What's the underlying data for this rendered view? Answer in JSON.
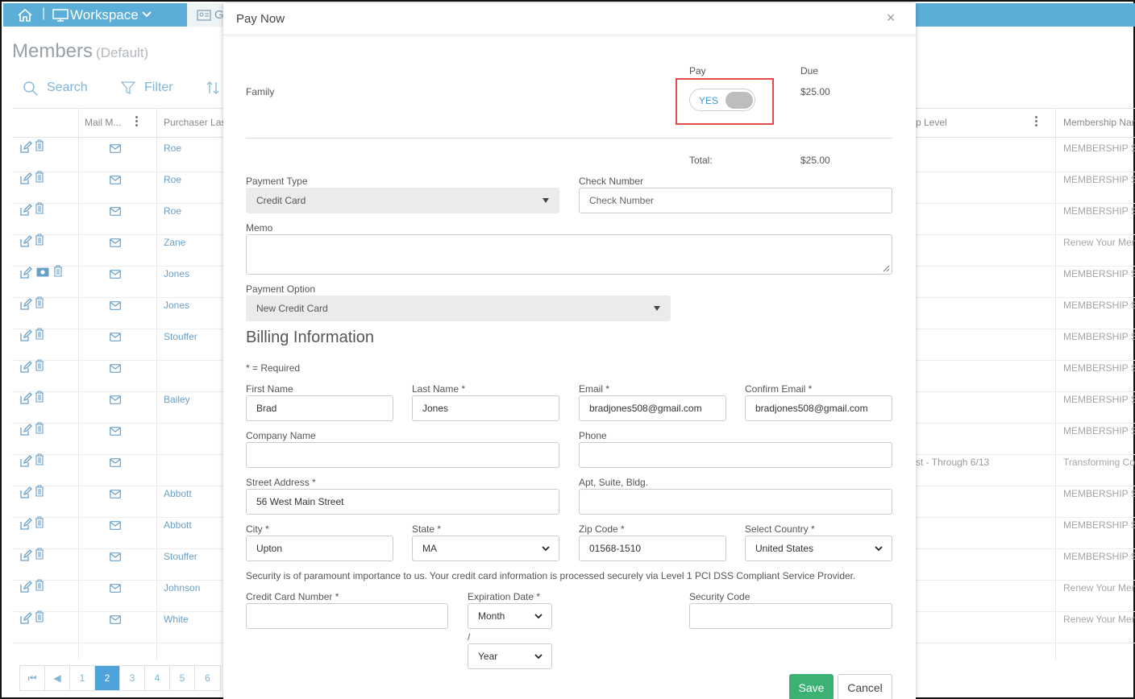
{
  "topbar": {
    "workspace_label": "Workspace",
    "tab2_label": "G"
  },
  "page": {
    "title": "Members",
    "subtitle": "(Default)"
  },
  "toolbar": {
    "search_label": "Search",
    "filter_label": "Filter"
  },
  "grid": {
    "columns": {
      "mail": "Mail M...",
      "purchaser": "Purchaser Las",
      "level": "p Level",
      "membership": "Membership Nar"
    },
    "rows": [
      {
        "last": "Roe",
        "level": "",
        "membership": "MEMBERSHIP SE",
        "money": false
      },
      {
        "last": "Roe",
        "level": "",
        "membership": "MEMBERSHIP SE",
        "money": false
      },
      {
        "last": "Roe",
        "level": "",
        "membership": "MEMBERSHIP SE",
        "money": false
      },
      {
        "last": "Zane",
        "level": "",
        "membership": "Renew Your Men",
        "money": false
      },
      {
        "last": "Jones",
        "level": "",
        "membership": "MEMBERSHIP SE",
        "money": true
      },
      {
        "last": "Jones",
        "level": "",
        "membership": "MEMBERSHIP SE",
        "money": false
      },
      {
        "last": "Stouffer",
        "level": "",
        "membership": "MEMBERSHIP SE",
        "money": false
      },
      {
        "last": "",
        "level": "",
        "membership": "MEMBERSHIP SE",
        "money": false
      },
      {
        "last": "Bailey",
        "level": "",
        "membership": "MEMBERSHIP SE",
        "money": false
      },
      {
        "last": "",
        "level": "",
        "membership": "MEMBERSHIP SE",
        "money": false
      },
      {
        "last": "",
        "level": "st - Through 6/13",
        "membership": "Transforming Co",
        "money": false
      },
      {
        "last": "Abbott",
        "level": "",
        "membership": "MEMBERSHIP SE",
        "money": false
      },
      {
        "last": "Abbott",
        "level": "",
        "membership": "MEMBERSHIP SE",
        "money": false
      },
      {
        "last": "Stouffer",
        "level": "",
        "membership": "MEMBERSHIP SE",
        "money": false
      },
      {
        "last": "Johnson",
        "level": "",
        "membership": "Renew Your Men",
        "money": false
      },
      {
        "last": "White",
        "level": "",
        "membership": "Renew Your Men",
        "money": false
      }
    ]
  },
  "pager": {
    "pages": [
      "1",
      "2",
      "3",
      "4",
      "5",
      "6"
    ],
    "current": "2"
  },
  "modal": {
    "title": "Pay Now",
    "close": "×",
    "pay_header": "Pay",
    "due_header": "Due",
    "item_label": "Family",
    "toggle_label": "YES",
    "toggle_on": true,
    "due_amount": "$25.00",
    "total_label": "Total:",
    "total_amount": "$25.00",
    "payment_type": {
      "label": "Payment Type",
      "value": "Credit Card"
    },
    "check_number": {
      "label": "Check Number",
      "placeholder": "Check Number"
    },
    "memo": {
      "label": "Memo"
    },
    "payment_option": {
      "label": "Payment Option",
      "value": "New Credit Card"
    },
    "billing": {
      "title": "Billing Information",
      "required_note": "* = Required",
      "first_name": {
        "label": "First Name",
        "value": "Brad"
      },
      "last_name": {
        "label": "Last Name *",
        "value": "Jones"
      },
      "email": {
        "label": "Email *",
        "value": "bradjones508@gmail.com"
      },
      "confirm_email": {
        "label": "Confirm Email *",
        "value": "bradjones508@gmail.com"
      },
      "company": {
        "label": "Company Name",
        "value": ""
      },
      "phone": {
        "label": "Phone",
        "value": ""
      },
      "street": {
        "label": "Street Address *",
        "value": "56 West Main Street"
      },
      "apt": {
        "label": "Apt, Suite, Bldg.",
        "value": ""
      },
      "city": {
        "label": "City *",
        "value": "Upton"
      },
      "state": {
        "label": "State *",
        "value": "MA"
      },
      "zip": {
        "label": "Zip Code *",
        "value": "01568-1510"
      },
      "country": {
        "label": "Select Country *",
        "value": "United States"
      },
      "security_note": "Security is of paramount importance to us. Your credit card information is processed securely via Level 1 PCI DSS Compliant Service Provider.",
      "cc_number": {
        "label": "Credit Card Number *",
        "value": ""
      },
      "expiration": {
        "label": "Expiration Date *",
        "month": "Month",
        "slash": "/",
        "year": "Year"
      },
      "security_code": {
        "label": "Security Code",
        "value": ""
      }
    },
    "save_label": "Save",
    "cancel_label": "Cancel"
  }
}
